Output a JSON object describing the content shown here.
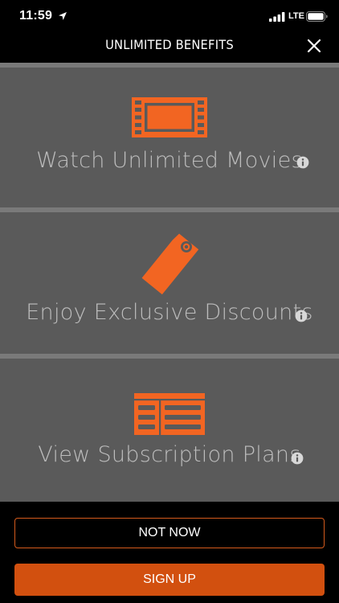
{
  "status_bar": {
    "time": "11:59",
    "network": "LTE",
    "icons": [
      "location-arrow-icon",
      "signal-bars-icon",
      "battery-icon"
    ]
  },
  "header": {
    "title": "UNLIMITED BENEFITS",
    "close_icon": "close-icon"
  },
  "benefits": [
    {
      "label": "Watch Unlimited Movies",
      "icon": "film-strip-icon",
      "info_icon": "info-icon"
    },
    {
      "label": "Enjoy Exclusive Discounts",
      "icon": "price-tag-icon",
      "info_icon": "info-icon"
    },
    {
      "label": "View Subscription Plans",
      "icon": "subscription-card-icon",
      "info_icon": "info-icon"
    }
  ],
  "actions": {
    "not_now": "NOT NOW",
    "sign_up": "SIGN UP"
  },
  "colors": {
    "accent": "#F26522",
    "button_fill": "#D2500F",
    "panel_background": "#5A5A5A",
    "divider": "#7A7A7A",
    "label_text": "#BDBDBD",
    "background": "#000000"
  }
}
